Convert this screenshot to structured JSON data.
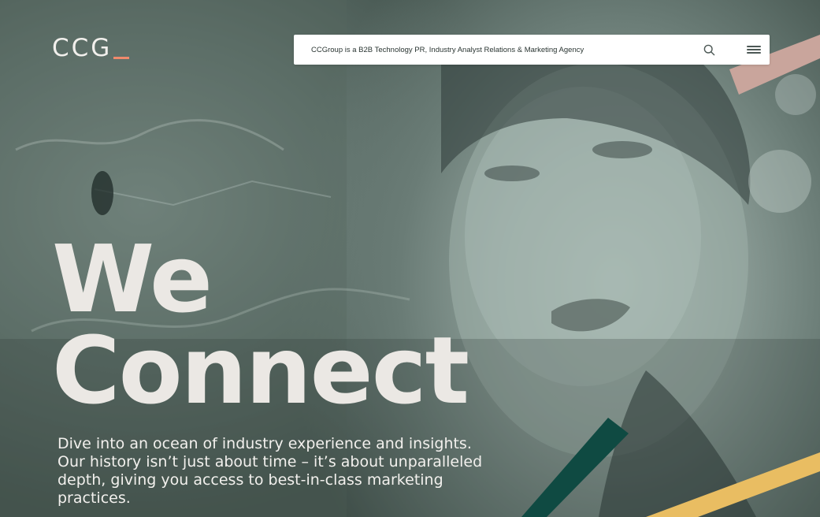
{
  "header": {
    "logo_text": "CCG",
    "logo_accent_color": "#f08a6c",
    "search_placeholder": "CCGroup is a B2B Technology PR, Industry Analyst Relations & Marketing Agency",
    "search_icon": "search-icon",
    "menu_icon": "hamburger-menu-icon"
  },
  "hero": {
    "headline_line1": "We",
    "headline_line2": "Connect",
    "intro": "Dive into an ocean of industry experience and insights. Our history isn’t just about time – it’s about unparalleled depth, giving you access to best-in-class marketing practices."
  },
  "colors": {
    "accent_pink": "#c9a59c",
    "accent_green": "#0f4a42",
    "accent_yellow": "#e9bd62",
    "overlay_tone": "#5f716b"
  }
}
